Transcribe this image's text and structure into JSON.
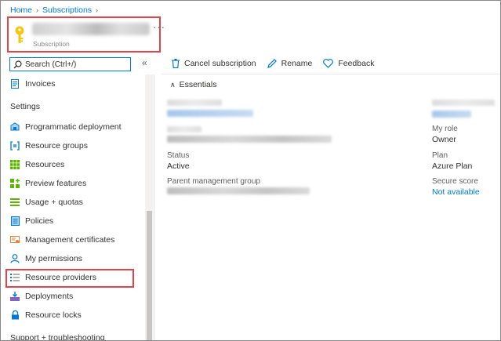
{
  "breadcrumb": {
    "items": [
      "Home",
      "Subscriptions"
    ]
  },
  "header": {
    "subtitle": "Subscription",
    "more_label": "···"
  },
  "search": {
    "placeholder": "Search (Ctrl+/)",
    "collapse_label": "«"
  },
  "sidebar": {
    "top_item": {
      "label": "Invoices",
      "icon": "invoice-icon"
    },
    "section_settings": "Settings",
    "items": [
      {
        "label": "Programmatic deployment",
        "icon": "programmatic-deployment-icon"
      },
      {
        "label": "Resource groups",
        "icon": "resource-groups-icon"
      },
      {
        "label": "Resources",
        "icon": "resources-grid-icon"
      },
      {
        "label": "Preview features",
        "icon": "preview-features-icon"
      },
      {
        "label": "Usage + quotas",
        "icon": "usage-quotas-icon"
      },
      {
        "label": "Policies",
        "icon": "policies-icon"
      },
      {
        "label": "Management certificates",
        "icon": "certificate-icon"
      },
      {
        "label": "My permissions",
        "icon": "person-icon"
      },
      {
        "label": "Resource providers",
        "icon": "resource-providers-icon"
      },
      {
        "label": "Deployments",
        "icon": "deployments-icon"
      },
      {
        "label": "Resource locks",
        "icon": "lock-icon"
      }
    ],
    "section_support": "Support + troubleshooting"
  },
  "toolbar": {
    "cancel_label": "Cancel subscription",
    "rename_label": "Rename",
    "feedback_label": "Feedback"
  },
  "essentials": {
    "title": "Essentials",
    "status_label": "Status",
    "status_value": "Active",
    "parent_group_label": "Parent management group",
    "my_role_label": "My role",
    "my_role_value": "Owner",
    "plan_label": "Plan",
    "plan_value": "Azure Plan",
    "secure_score_label": "Secure score",
    "secure_score_value": "Not available"
  },
  "colors": {
    "accent": "#0078d4",
    "highlight_border": "#e2444b",
    "key_icon": "#f2c811"
  }
}
